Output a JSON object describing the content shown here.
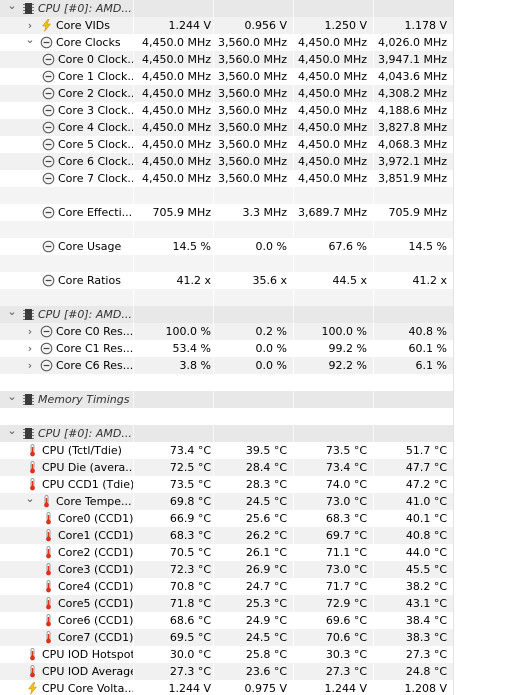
{
  "rows": [
    {
      "type": "group",
      "depth": 0,
      "chevron": "down",
      "icon": "chip-icon",
      "label": "CPU [#0]: AMD...",
      "v": [
        "",
        "",
        "",
        ""
      ]
    },
    {
      "type": "item",
      "depth": 1,
      "chevron": "right",
      "icon": "lightning-icon",
      "label": "Core VIDs",
      "v": [
        "1.244 V",
        "0.956 V",
        "1.250 V",
        "1.178 V"
      ]
    },
    {
      "type": "item",
      "depth": 1,
      "chevron": "down",
      "icon": "clock-icon",
      "label": "Core Clocks",
      "v": [
        "4,450.0 MHz",
        "3,560.0 MHz",
        "4,450.0 MHz",
        "4,026.0 MHz"
      ]
    },
    {
      "type": "item",
      "depth": 2,
      "chevron": "",
      "icon": "clock-icon",
      "label": "Core 0 Clock...",
      "v": [
        "4,450.0 MHz",
        "3,560.0 MHz",
        "4,450.0 MHz",
        "3,947.1 MHz"
      ]
    },
    {
      "type": "item",
      "depth": 2,
      "chevron": "",
      "icon": "clock-icon",
      "label": "Core 1 Clock...",
      "v": [
        "4,450.0 MHz",
        "3,560.0 MHz",
        "4,450.0 MHz",
        "4,043.6 MHz"
      ]
    },
    {
      "type": "item",
      "depth": 2,
      "chevron": "",
      "icon": "clock-icon",
      "label": "Core 2 Clock...",
      "v": [
        "4,450.0 MHz",
        "3,560.0 MHz",
        "4,450.0 MHz",
        "4,308.2 MHz"
      ]
    },
    {
      "type": "item",
      "depth": 2,
      "chevron": "",
      "icon": "clock-icon",
      "label": "Core 3 Clock...",
      "v": [
        "4,450.0 MHz",
        "3,560.0 MHz",
        "4,450.0 MHz",
        "4,188.6 MHz"
      ]
    },
    {
      "type": "item",
      "depth": 2,
      "chevron": "",
      "icon": "clock-icon",
      "label": "Core 4 Clock...",
      "v": [
        "4,450.0 MHz",
        "3,560.0 MHz",
        "4,450.0 MHz",
        "3,827.8 MHz"
      ]
    },
    {
      "type": "item",
      "depth": 2,
      "chevron": "",
      "icon": "clock-icon",
      "label": "Core 5 Clock...",
      "v": [
        "4,450.0 MHz",
        "3,560.0 MHz",
        "4,450.0 MHz",
        "4,068.3 MHz"
      ]
    },
    {
      "type": "item",
      "depth": 2,
      "chevron": "",
      "icon": "clock-icon",
      "label": "Core 6 Clock...",
      "v": [
        "4,450.0 MHz",
        "3,560.0 MHz",
        "4,450.0 MHz",
        "3,972.1 MHz"
      ]
    },
    {
      "type": "item",
      "depth": 2,
      "chevron": "",
      "icon": "clock-icon",
      "label": "Core 7 Clock...",
      "v": [
        "4,450.0 MHz",
        "3,560.0 MHz",
        "4,450.0 MHz",
        "3,851.9 MHz"
      ]
    },
    {
      "type": "blank"
    },
    {
      "type": "item",
      "depth": 2,
      "chevron": "",
      "icon": "clock-icon",
      "label": "Core Effecti...",
      "v": [
        "705.9 MHz",
        "3.3 MHz",
        "3,689.7 MHz",
        "705.9 MHz"
      ]
    },
    {
      "type": "blank"
    },
    {
      "type": "item",
      "depth": 2,
      "chevron": "",
      "icon": "clock-icon",
      "label": "Core Usage",
      "v": [
        "14.5 %",
        "0.0 %",
        "67.6 %",
        "14.5 %"
      ]
    },
    {
      "type": "blank"
    },
    {
      "type": "item",
      "depth": 2,
      "chevron": "",
      "icon": "clock-icon",
      "label": "Core Ratios",
      "v": [
        "41.2 x",
        "35.6 x",
        "44.5 x",
        "41.2 x"
      ]
    },
    {
      "type": "blank"
    },
    {
      "type": "group",
      "depth": 0,
      "chevron": "down",
      "icon": "chip-icon",
      "label": "CPU [#0]: AMD...",
      "v": [
        "",
        "",
        "",
        ""
      ]
    },
    {
      "type": "item",
      "depth": 1,
      "chevron": "right",
      "icon": "clock-icon",
      "label": "Core C0 Res...",
      "v": [
        "100.0 %",
        "0.2 %",
        "100.0 %",
        "40.8 %"
      ]
    },
    {
      "type": "item",
      "depth": 1,
      "chevron": "right",
      "icon": "clock-icon",
      "label": "Core C1 Res...",
      "v": [
        "53.4 %",
        "0.0 %",
        "99.2 %",
        "60.1 %"
      ]
    },
    {
      "type": "item",
      "depth": 1,
      "chevron": "right",
      "icon": "clock-icon",
      "label": "Core C6 Res...",
      "v": [
        "3.8 %",
        "0.0 %",
        "92.2 %",
        "6.1 %"
      ]
    },
    {
      "type": "blank"
    },
    {
      "type": "group",
      "depth": 0,
      "chevron": "down",
      "icon": "chip-icon",
      "label": "Memory Timings",
      "v": [
        "",
        "",
        "",
        ""
      ]
    },
    {
      "type": "blank"
    },
    {
      "type": "group",
      "depth": 0,
      "chevron": "down",
      "icon": "chip-icon",
      "label": "CPU [#0]: AMD...",
      "v": [
        "",
        "",
        "",
        ""
      ]
    },
    {
      "type": "item",
      "depth": 0,
      "chevron": "",
      "icon": "thermometer-icon",
      "label": "CPU (Tctl/Tdie)",
      "v": [
        "73.4 °C",
        "39.5 °C",
        "73.5 °C",
        "51.7 °C"
      ]
    },
    {
      "type": "item",
      "depth": 0,
      "chevron": "",
      "icon": "thermometer-icon",
      "label": "CPU Die (avera...",
      "v": [
        "72.5 °C",
        "28.4 °C",
        "73.4 °C",
        "47.7 °C"
      ]
    },
    {
      "type": "item",
      "depth": 0,
      "chevron": "",
      "icon": "thermometer-icon",
      "label": "CPU CCD1 (Tdie)",
      "v": [
        "73.5 °C",
        "28.3 °C",
        "74.0 °C",
        "47.2 °C"
      ]
    },
    {
      "type": "item",
      "depth": 1,
      "chevron": "down",
      "icon": "thermometer-icon",
      "label": "Core Tempe...",
      "v": [
        "69.8 °C",
        "24.5 °C",
        "73.0 °C",
        "41.0 °C"
      ]
    },
    {
      "type": "item",
      "depth": 2,
      "chevron": "",
      "icon": "thermometer-icon",
      "label": "Core0 (CCD1)",
      "v": [
        "66.9 °C",
        "25.6 °C",
        "68.3 °C",
        "40.1 °C"
      ]
    },
    {
      "type": "item",
      "depth": 2,
      "chevron": "",
      "icon": "thermometer-icon",
      "label": "Core1 (CCD1)",
      "v": [
        "68.3 °C",
        "26.2 °C",
        "69.7 °C",
        "40.8 °C"
      ]
    },
    {
      "type": "item",
      "depth": 2,
      "chevron": "",
      "icon": "thermometer-icon",
      "label": "Core2 (CCD1)",
      "v": [
        "70.5 °C",
        "26.1 °C",
        "71.1 °C",
        "44.0 °C"
      ]
    },
    {
      "type": "item",
      "depth": 2,
      "chevron": "",
      "icon": "thermometer-icon",
      "label": "Core3 (CCD1)",
      "v": [
        "72.3 °C",
        "26.9 °C",
        "73.0 °C",
        "45.5 °C"
      ]
    },
    {
      "type": "item",
      "depth": 2,
      "chevron": "",
      "icon": "thermometer-icon",
      "label": "Core4 (CCD1)",
      "v": [
        "70.8 °C",
        "24.7 °C",
        "71.7 °C",
        "38.2 °C"
      ]
    },
    {
      "type": "item",
      "depth": 2,
      "chevron": "",
      "icon": "thermometer-icon",
      "label": "Core5 (CCD1)",
      "v": [
        "71.8 °C",
        "25.3 °C",
        "72.9 °C",
        "43.1 °C"
      ]
    },
    {
      "type": "item",
      "depth": 2,
      "chevron": "",
      "icon": "thermometer-icon",
      "label": "Core6 (CCD1)",
      "v": [
        "68.6 °C",
        "24.9 °C",
        "69.6 °C",
        "38.4 °C"
      ]
    },
    {
      "type": "item",
      "depth": 2,
      "chevron": "",
      "icon": "thermometer-icon",
      "label": "Core7 (CCD1)",
      "v": [
        "69.5 °C",
        "24.5 °C",
        "70.6 °C",
        "38.3 °C"
      ]
    },
    {
      "type": "item",
      "depth": 0,
      "chevron": "",
      "icon": "thermometer-icon",
      "label": "CPU IOD Hotspot",
      "v": [
        "30.0 °C",
        "25.8 °C",
        "30.3 °C",
        "27.3 °C"
      ]
    },
    {
      "type": "item",
      "depth": 0,
      "chevron": "",
      "icon": "thermometer-icon",
      "label": "CPU IOD Average",
      "v": [
        "27.3 °C",
        "23.6 °C",
        "27.3 °C",
        "24.8 °C"
      ]
    },
    {
      "type": "item",
      "depth": 0,
      "chevron": "",
      "icon": "lightning-icon",
      "label": "CPU Core Volta...",
      "v": [
        "1.244 V",
        "0.975 V",
        "1.244 V",
        "1.208 V"
      ]
    }
  ],
  "colors": {
    "group_bg": "#e8e8e8",
    "alt_bg": "#f1f1f1",
    "thermo_red": "#d9341b",
    "volt_yellow": "#f2c21a",
    "chip_dark": "#3b3b3b"
  }
}
